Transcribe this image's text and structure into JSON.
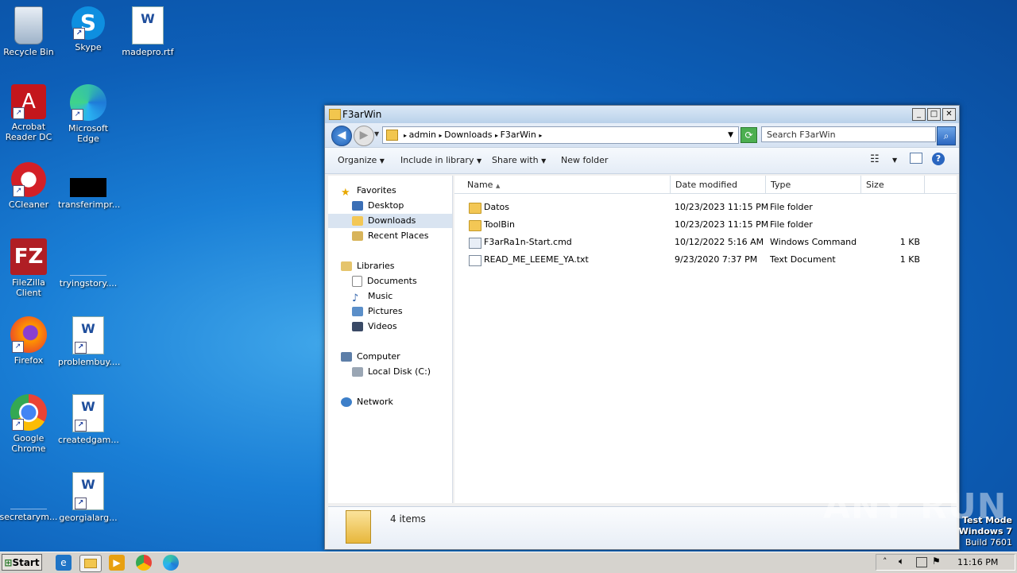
{
  "desktop": {
    "icons": [
      {
        "label": "Recycle Bin",
        "icon": "recycle-bin-icon"
      },
      {
        "label": "Skype",
        "icon": "skype-icon"
      },
      {
        "label": "madepro.rtf",
        "icon": "word-document-icon"
      },
      {
        "label": "Acrobat Reader DC",
        "icon": "acrobat-icon"
      },
      {
        "label": "Microsoft Edge",
        "icon": "edge-icon"
      },
      {
        "label": "CCleaner",
        "icon": "ccleaner-icon"
      },
      {
        "label": "transferimpr...",
        "icon": "black-file-icon"
      },
      {
        "label": "FileZilla Client",
        "icon": "filezilla-icon"
      },
      {
        "label": "tryingstory....",
        "icon": "blank-file-icon"
      },
      {
        "label": "Firefox",
        "icon": "firefox-icon"
      },
      {
        "label": "problembuy....",
        "icon": "word-document-icon"
      },
      {
        "label": "Google Chrome",
        "icon": "chrome-icon"
      },
      {
        "label": "createdgam...",
        "icon": "word-document-icon"
      },
      {
        "label": "secretarym...",
        "icon": "blank-file-icon"
      },
      {
        "label": "georgialarg...",
        "icon": "word-document-icon"
      }
    ]
  },
  "window": {
    "title": "F3arWin",
    "breadcrumbs": [
      "admin",
      "Downloads",
      "F3arWin"
    ],
    "search_placeholder": "Search F3arWin",
    "commands": {
      "organize": "Organize",
      "include": "Include in library",
      "share": "Share with",
      "new_folder": "New folder"
    },
    "nav": {
      "favorites": "Favorites",
      "desktop": "Desktop",
      "downloads": "Downloads",
      "recent": "Recent Places",
      "libraries": "Libraries",
      "documents": "Documents",
      "music": "Music",
      "pictures": "Pictures",
      "videos": "Videos",
      "computer": "Computer",
      "local_disk": "Local Disk (C:)",
      "network": "Network"
    },
    "columns": {
      "name": "Name",
      "date": "Date modified",
      "type": "Type",
      "size": "Size"
    },
    "files": [
      {
        "name": "Datos",
        "date": "10/23/2023 11:15 PM",
        "type": "File folder",
        "size": ""
      },
      {
        "name": "ToolBin",
        "date": "10/23/2023 11:15 PM",
        "type": "File folder",
        "size": ""
      },
      {
        "name": "F3arRa1n-Start.cmd",
        "date": "10/12/2022 5:16 AM",
        "type": "Windows Command ...",
        "size": "1 KB"
      },
      {
        "name": "READ_ME_LEEME_YA.txt",
        "date": "9/23/2020 7:37 PM",
        "type": "Text Document",
        "size": "1 KB"
      }
    ],
    "status": "4 items"
  },
  "taskbar": {
    "start": "Start",
    "clock": "11:16 PM"
  },
  "overlay": {
    "watermark": "ANY RUN",
    "test_mode": "Test Mode",
    "os": "Windows 7",
    "build": "Build 7601"
  }
}
